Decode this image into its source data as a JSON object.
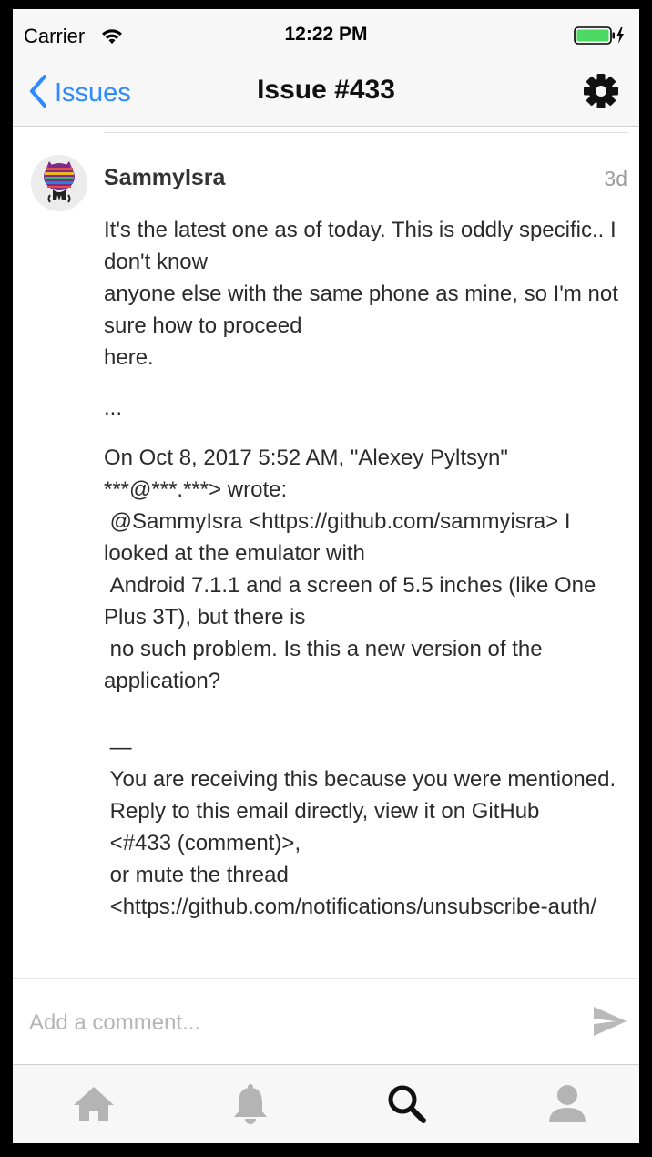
{
  "status_bar": {
    "carrier": "Carrier",
    "time": "12:22 PM",
    "wifi_icon": "wifi-icon",
    "battery_icon": "battery-charging-icon",
    "battery_color": "#4cd964"
  },
  "nav": {
    "back_label": "Issues",
    "title": "Issue #433",
    "settings_icon": "gear-icon",
    "accent_color": "#2e8bff"
  },
  "comment": {
    "author": "SammyIsra",
    "age": "3d",
    "body": {
      "para1": [
        "It's the latest one as of today. This is oddly specific.. I don't know",
        "anyone else with the same phone as mine, so I'm not sure how to proceed",
        "here."
      ],
      "ellipsis": "...",
      "quote": [
        "On Oct 8, 2017 5:52 AM, \"Alexey Pyltsyn\"",
        "***@***.***> wrote:",
        " @SammyIsra <https://github.com/sammyisra> I looked at the emulator with",
        " Android 7.1.1 and a screen of 5.5 inches (like One Plus 3T), but there is",
        " no such problem. Is this a new version of the application?"
      ],
      "footer": [
        " —",
        " You are receiving this because you were mentioned.",
        " Reply to this email directly, view it on GitHub",
        " <#433 (comment)>,",
        " or mute the thread",
        " <https://github.com/notifications/unsubscribe-auth/"
      ]
    }
  },
  "composer": {
    "placeholder": "Add a comment...",
    "send_icon": "send-icon"
  },
  "tabs": [
    {
      "icon": "home-icon"
    },
    {
      "icon": "bell-icon"
    },
    {
      "icon": "search-icon"
    },
    {
      "icon": "profile-icon"
    }
  ]
}
